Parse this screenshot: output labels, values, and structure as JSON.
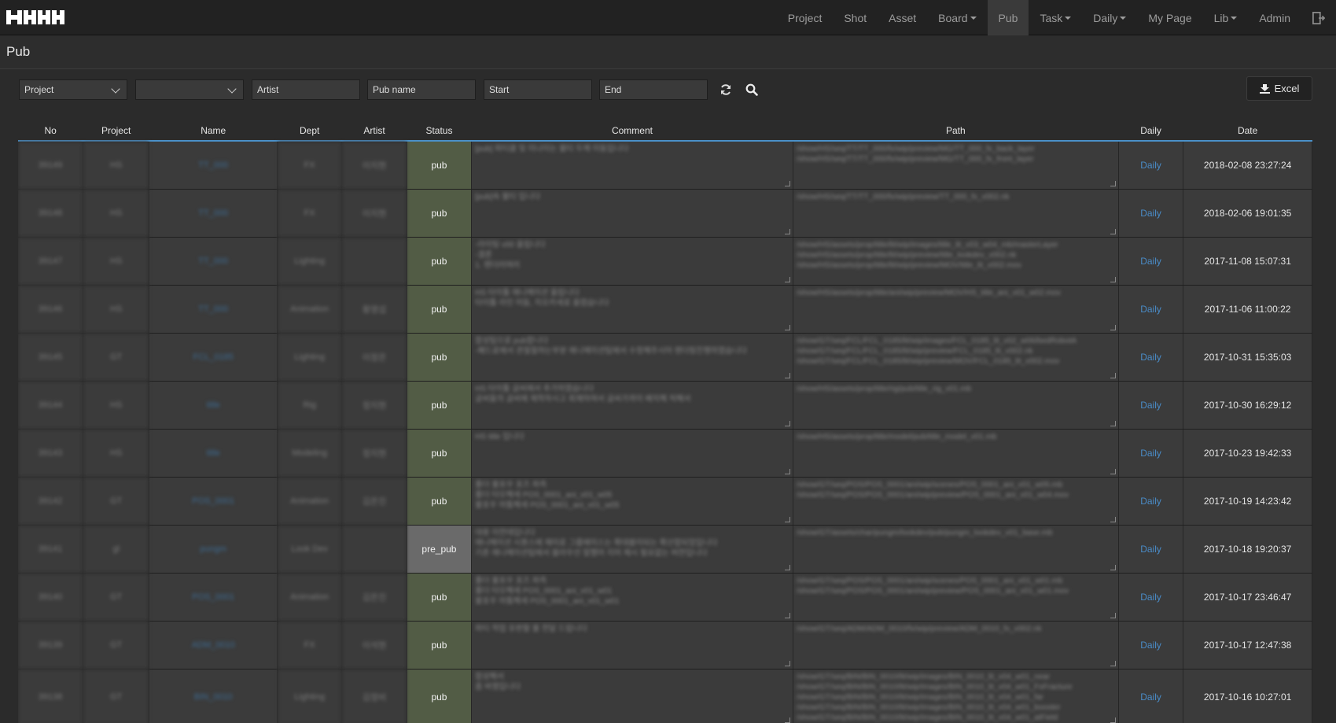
{
  "nav": {
    "items": [
      {
        "label": "Project",
        "dropdown": false
      },
      {
        "label": "Shot",
        "dropdown": false
      },
      {
        "label": "Asset",
        "dropdown": false
      },
      {
        "label": "Board",
        "dropdown": true
      },
      {
        "label": "Pub",
        "dropdown": false,
        "active": true
      },
      {
        "label": "Task",
        "dropdown": true
      },
      {
        "label": "Daily",
        "dropdown": true
      },
      {
        "label": "My Page",
        "dropdown": false
      },
      {
        "label": "Lib",
        "dropdown": true
      },
      {
        "label": "Admin",
        "dropdown": false
      }
    ]
  },
  "page": {
    "title": "Pub"
  },
  "filters": {
    "project_select": "Project",
    "dept_select": "",
    "artist_placeholder": "Artist",
    "pubname_placeholder": "Pub name",
    "start_placeholder": "Start",
    "end_placeholder": "End",
    "excel_label": "Excel"
  },
  "table": {
    "headers": [
      "No",
      "Project",
      "Name",
      "Dept",
      "Artist",
      "Status",
      "Comment",
      "Path",
      "Daily",
      "Date"
    ],
    "rows": [
      {
        "no": "39149",
        "project": "HS",
        "name": "TT_000",
        "dept": "FX",
        "artist": "이지현",
        "status": "pub",
        "comment": "[pub] 파티클 및 이나이는 불티 두께 이동입니다",
        "path": "/show/HS/seq/TT/TT_000/fx/wip/preview/MG/TT_000_fx_back_layer\n/show/HS/seq/TT/TT_000/fx/wip/preview/MG/TT_000_fx_front_layer",
        "daily": "Daily",
        "date": "2018-02-08 23:27:24"
      },
      {
        "no": "39148",
        "project": "HS",
        "name": "TT_000",
        "dept": "FX",
        "artist": "이지현",
        "status": "pub",
        "comment": "[pub]속 불티 입니다",
        "path": "/show/HS/seq/TT/TT_000/fx/wip/preview/TT_000_fx_v002.nk",
        "daily": "Daily",
        "date": "2018-02-06 19:01:35"
      },
      {
        "no": "39147",
        "project": "HS",
        "name": "TT_000",
        "dept": "Lighting",
        "artist": "",
        "status": "pub",
        "comment": "-라이팅 v00 올립니다\n-결론\n1. 렌더러여러",
        "path": "/show/HS/assets/prop/title/lit/wip/images/title_lit_v03_w04_mb/masterLayer\n/show/HS/assets/prop/title/lit/wip/preview/title_lookdev_v002.nk\n/show/HS/assets/prop/title/lit/wip/preview/MOV/title_lit_v002.mov",
        "daily": "Daily",
        "date": "2017-11-08 15:07:31"
      },
      {
        "no": "39146",
        "project": "HS",
        "name": "TT_000",
        "dept": "Animation",
        "artist": "황영섭",
        "status": "pub",
        "comment": "HS 타이틀 애니메이션 올립니다\n타이틀 라인 어둠, 치오카세로 올렸습니다",
        "path": "/show/HS/assets/prop/title/ani/wip/preview/MOV/HS_title_ani_v01_w02.mov",
        "daily": "Daily",
        "date": "2017-11-06 11:00:22"
      },
      {
        "no": "39145",
        "project": "GT",
        "name": "FCL_0185",
        "dept": "Lighting",
        "artist": "이정은",
        "status": "pub",
        "comment": "합성팀으로 pub합니다\n-패드로에서 관절절하는부분 애니메이션팀에서 수정해주시어 렌더링진행하였습니다",
        "path": "/show/GT/seq/FCL/FCL_0185/lit/wip/images/FCL_0185_lit_v02_w06/bedRobotA\n/show/GT/seq/FCL/FCL_0185/lit/wip/preview/FCL_0185_lit_v002.nk\n/show/GT/seq/FCL/FCL_0185/lit/wip/preview/MOV/FCL_0185_lit_v002.mov",
        "daily": "Daily",
        "date": "2017-10-31 15:35:03"
      },
      {
        "no": "39144",
        "project": "HS",
        "name": "title",
        "dept": "Rig",
        "artist": "정지현",
        "status": "pub",
        "comment": "HS 타이틀 글씨에서 추가하였습니다\n글씨들의 글씨에 제작하시고 회재하여서 글씨가까이 배치해 처해서",
        "path": "/show/HS/assets/prop/title/rig/pub/title_rig_v01.mb",
        "daily": "Daily",
        "date": "2017-10-30 16:29:12"
      },
      {
        "no": "39143",
        "project": "HS",
        "name": "title",
        "dept": "Modeling",
        "artist": "정지현",
        "status": "pub",
        "comment": "HS title 입니다",
        "path": "/show/HS/assets/prop/title/model/pub/title_model_v01.mb",
        "daily": "Daily",
        "date": "2017-10-23 19:42:33"
      },
      {
        "no": "39142",
        "project": "GT",
        "name": "POS_0001",
        "dept": "Animation",
        "artist": "김은진",
        "status": "pub",
        "comment": "폴더 불포우 포즈 좌측\n폴더 타오해세      POS_0001_ani_v01_w05\n불포우 마툼해세   POS_0001_ani_v01_w05",
        "path": "/show/GT/seq/POS/POS_0001/ani/wip/scenes/POS_0001_ani_v01_w05.mb\n/show/GT/seq/POS/POS_0001/ani/wip/preview/POS_0001_ani_v01_w04.mov",
        "daily": "Daily",
        "date": "2017-10-19 14:23:42"
      },
      {
        "no": "39141",
        "project": "gl",
        "name": "pungm",
        "dept": "Look Dev",
        "artist": "",
        "status": "pre_pub",
        "comment": "대용 이전데입니다\n애니메이션 시퀀스에 재미로 그룹에이스는 확대봅이되는 확산합되었입니다\n기존 애니메이션팀에서 블라우선 말했어 지어 제시 필요없는 버전입니다",
        "path": "/show/GT/assets/char/pungm/lookdev/pub/pungm_lookdev_v01_base.mb",
        "daily": "Daily",
        "date": "2017-10-18 19:20:37"
      },
      {
        "no": "39140",
        "project": "GT",
        "name": "POS_0001",
        "dept": "Animation",
        "artist": "김은진",
        "status": "pub",
        "comment": "폴더 불포우 포즈 좌측\n폴더 타오해세      POS_0001_ani_v01_w01\n불포우 마툼해세   POS_0001_ani_v01_w01",
        "path": "/show/GT/seq/POS/POS_0001/ani/wip/scenes/POS_0001_ani_v01_w01.mb\n/show/GT/seq/POS/POS_0001/ani/wip/preview/POS_0001_ani_v01_w01.mov",
        "daily": "Daily",
        "date": "2017-10-17 23:46:47"
      },
      {
        "no": "39139",
        "project": "GT",
        "name": "ADM_0010",
        "dept": "FX",
        "artist": "이석현",
        "status": "pub",
        "comment": "파티 작업 유판할 불 전달 드립니다",
        "path": "/show/GT/seq/ADM/ADM_0010/fx/wip/preview/ADM_0010_fx_v002.nk",
        "daily": "Daily",
        "date": "2017-10-17 12:47:38"
      },
      {
        "no": "39138",
        "project": "GT",
        "name": "BIN_0010",
        "dept": "Lighting",
        "artist": "김정비",
        "status": "pub",
        "comment": "합성해서\n좀 바꿨입니다",
        "path": "/show/GT/seq/BIN/BIN_0010/lit/wip/images/BIN_0010_lit_v04_w01_near\n/show/GT/seq/BIN/BIN_0010/lit/wip/images/BIN_0010_lit_v04_w01_FxFracture\n/show/GT/seq/BIN/BIN_0010/lit/wip/images/BIN_0010_lit_v04_w01_far\n/show/GT/seq/BIN/BIN_0010/lit/wip/images/BIN_0010_lit_v04_w01_booster\n/show/GT/seq/BIN/BIN_0010/lit/wip/images/BIN_0010_lit_v04_w01_atField",
        "daily": "Daily",
        "date": "2017-10-16 10:27:01"
      }
    ]
  },
  "icons": {
    "refresh": "refresh-icon",
    "search": "search-icon",
    "excel": "download-icon",
    "logout": "logout-icon"
  },
  "colors": {
    "accent": "#4a90c8",
    "status_pub": "#525c45",
    "status_pre_pub": "#6a6a6a",
    "navbar": "#222222"
  }
}
